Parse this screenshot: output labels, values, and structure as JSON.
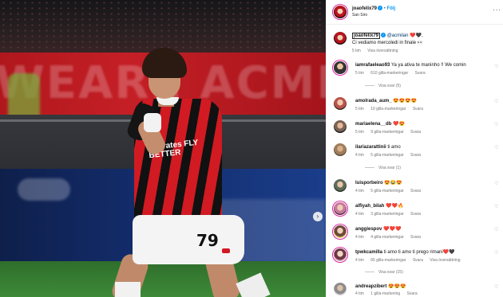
{
  "post": {
    "author": "joaofelix79",
    "follow_label": "Följ",
    "location": "San Siro",
    "more_icon": "ellipsis-icon",
    "jersey_sponsor": "Emirates FLY BETTER",
    "shorts_number": "79"
  },
  "caption": {
    "username": "joaofelix79",
    "mention": "@acmilan",
    "emoji": "❤️🖤,",
    "text_line2": "Ci vediamo mercoledi in finale 👀",
    "time": "5 tim",
    "translation_label": "Visa översättning"
  },
  "comments": [
    {
      "username": "iamrafaeleao93",
      "text": "Ya ya ativa te maninho !! We comin",
      "time": "5 tim",
      "likes": "610 gilla-markeringar",
      "reply": "Svara",
      "view_replies": "Visa svar (5)"
    },
    {
      "username": "amolrada_aum_",
      "text": "😍😍😍😍",
      "time": "5 tim",
      "likes": "10 gilla-markeringar",
      "reply": "Svara"
    },
    {
      "username": "mariaelena__db",
      "text": "❤️😍",
      "time": "5 tim",
      "likes": "9 gilla-markeringar",
      "reply": "Svara"
    },
    {
      "username": "ilariazarattinii",
      "text": "ti amo",
      "time": "4 tim",
      "likes": "5 gilla-markeringar",
      "reply": "Svara",
      "view_replies": "Visa svar (1)"
    },
    {
      "username": "luisporbeiro",
      "text": "😍😂😍",
      "time": "4 tim",
      "likes": "5 gilla-markeringar",
      "reply": "Svara"
    },
    {
      "username": "alfiyah_bilah",
      "text": "❤️❤️🔥",
      "time": "4 tim",
      "likes": "3 gilla-markeringar",
      "reply": "Svara"
    },
    {
      "username": "anggiespov",
      "text": "❤️❤️❤️",
      "time": "4 tim",
      "likes": "4 gilla-markeringar",
      "reply": "Svara"
    },
    {
      "username": "tpwkcamilla",
      "text": "ti amo ti amo ti prego rimani❤️🖤",
      "time": "4 tim",
      "likes": "65 gilla-markeringar",
      "reply": "Svara",
      "translation": "Visa översättning",
      "view_replies": "Visa svar (15)"
    },
    {
      "username": "andreapzibert",
      "text": "😍😍😍",
      "time": "4 tim",
      "likes": "1 gilla-markering",
      "reply": "Svara"
    }
  ],
  "icons": {
    "like": "heart-icon",
    "next": "chevron-right-icon"
  },
  "colors": {
    "accent": "#0095f6",
    "milan_red": "#d11a22"
  }
}
